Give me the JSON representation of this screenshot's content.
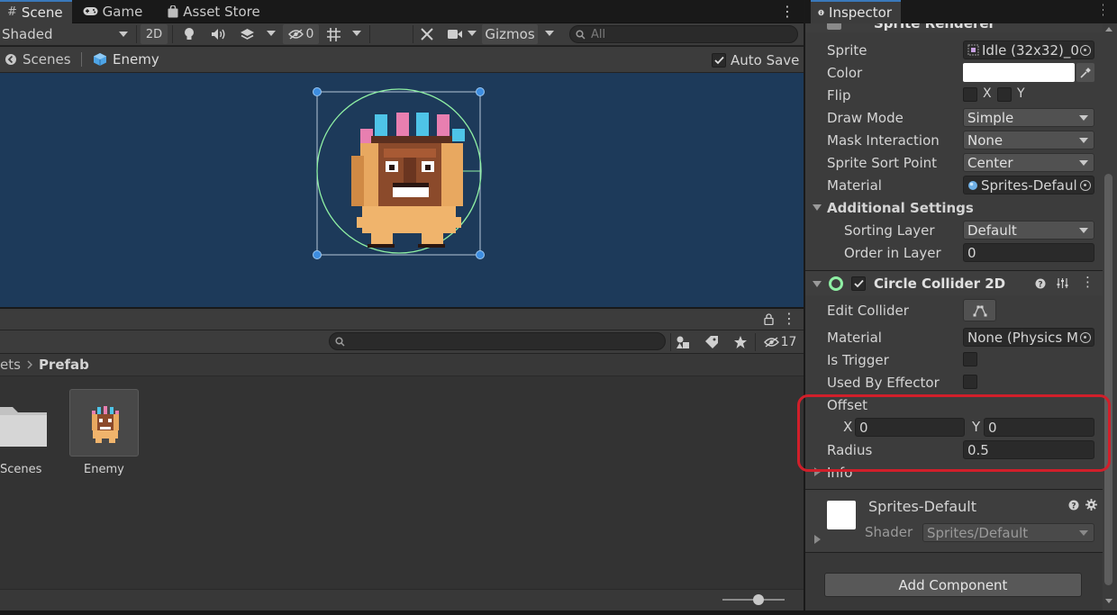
{
  "scene_window": {
    "tabs": [
      {
        "label": "Scene",
        "icon": "grid-icon",
        "active": true
      },
      {
        "label": "Game",
        "icon": "gamepad-icon",
        "active": false
      },
      {
        "label": "Asset Store",
        "icon": "shopping-bag-icon",
        "active": false
      }
    ],
    "toolbar": {
      "shading_mode": "Shaded",
      "mode_2d_label": "2D",
      "hidden_count": "0",
      "gizmos_label": "Gizmos",
      "search_placeholder": "All"
    },
    "breadcrumb": {
      "root_label": "Scenes",
      "current_label": "Enemy",
      "auto_save_label": "Auto Save",
      "auto_save_checked": true
    }
  },
  "project_window": {
    "visible_count": "17",
    "path": {
      "parent_partial": "ets",
      "current": "Prefab"
    },
    "items": [
      {
        "label": "Scenes",
        "icon": "folder-icon"
      },
      {
        "label": "Enemy",
        "icon": "prefab-thumbnail"
      }
    ]
  },
  "inspector": {
    "tab_label": "Inspector",
    "sprite_renderer": {
      "header_label": "Sprite Renderer",
      "sprite_label": "Sprite",
      "sprite_value": "Idle (32x32)_0",
      "color_label": "Color",
      "color_value": "#ffffff",
      "flip_label": "Flip",
      "flip_x_label": "X",
      "flip_y_label": "Y",
      "draw_mode_label": "Draw Mode",
      "draw_mode_value": "Simple",
      "mask_interaction_label": "Mask Interaction",
      "mask_interaction_value": "None",
      "sprite_sort_point_label": "Sprite Sort Point",
      "sprite_sort_point_value": "Center",
      "material_label": "Material",
      "material_value": "Sprites-Defaul",
      "additional_settings_label": "Additional Settings",
      "sorting_layer_label": "Sorting Layer",
      "sorting_layer_value": "Default",
      "order_in_layer_label": "Order in Layer",
      "order_in_layer_value": "0"
    },
    "circle_collider": {
      "header_label": "Circle Collider 2D",
      "enabled": true,
      "edit_collider_label": "Edit Collider",
      "material_label": "Material",
      "material_value": "None (Physics M",
      "is_trigger_label": "Is Trigger",
      "used_by_effector_label": "Used By Effector",
      "offset_label": "Offset",
      "offset_x_label": "X",
      "offset_x_value": "0",
      "offset_y_label": "Y",
      "offset_y_value": "0",
      "radius_label": "Radius",
      "radius_value": "0.5",
      "info_label": "Info"
    },
    "material_section": {
      "name": "Sprites-Default",
      "shader_label": "Shader",
      "shader_value": "Sprites/Default"
    },
    "add_component_label": "Add Component"
  },
  "colors": {
    "accent": "#3a79bb",
    "scene_bg": "#1d3a5a",
    "highlight": "#d11f2a",
    "collider_green": "#8ff0a4"
  }
}
